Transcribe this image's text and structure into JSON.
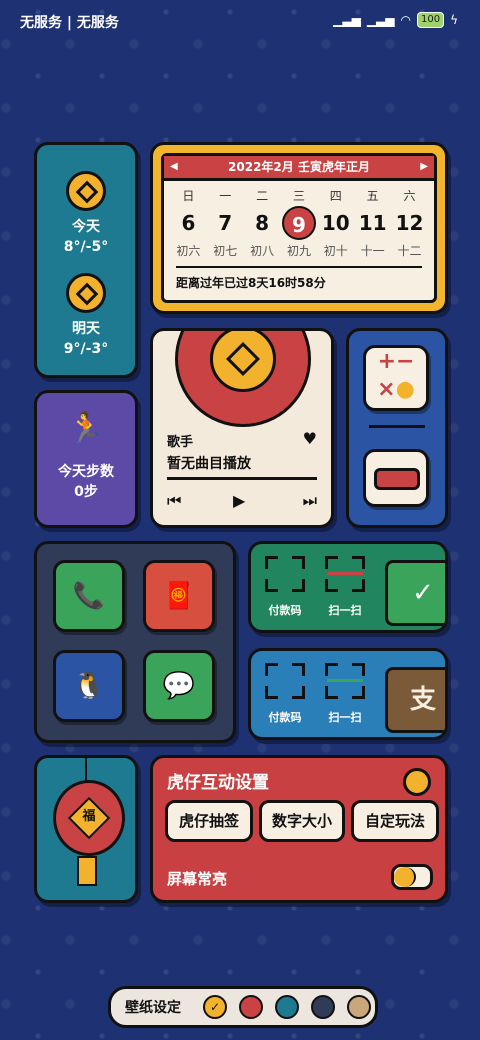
{
  "status_bar": {
    "carrier": "无服务 | 无服务",
    "battery": "100"
  },
  "weather": {
    "today_label": "今天",
    "today_temp": "8°/-5°",
    "tomorrow_label": "明天",
    "tomorrow_temp": "9°/-3°"
  },
  "calendar": {
    "title": "2022年2月  壬寅虎年正月",
    "weekdays": [
      "日",
      "一",
      "二",
      "三",
      "四",
      "五",
      "六"
    ],
    "days": [
      "6",
      "7",
      "8",
      "9",
      "10",
      "11",
      "12"
    ],
    "lunar": [
      "初六",
      "初七",
      "初八",
      "初九",
      "初十",
      "十一",
      "十二"
    ],
    "today_index": 3,
    "countdown": "距离过年已过8天16时58分"
  },
  "steps": {
    "label": "今天步数",
    "value": "0步"
  },
  "music": {
    "artist": "歌手",
    "track": "暂无曲目播放"
  },
  "pay_green": {
    "pay_code": "付款码",
    "scan": "扫一扫"
  },
  "pay_blue": {
    "pay_code": "付款码",
    "scan": "扫一扫",
    "alipay_char": "支"
  },
  "lantern": {
    "char": "福"
  },
  "tiger": {
    "title": "虎仔互动设置",
    "buttons": [
      "虎仔抽签",
      "数字大小",
      "自定玩法"
    ],
    "screen_on": "屏幕常亮"
  },
  "wallpaper": {
    "label": "壁纸设定",
    "colors": [
      "#f3b22e",
      "#c94244",
      "#1d7a90",
      "#303b57",
      "#c9a77b"
    ]
  }
}
